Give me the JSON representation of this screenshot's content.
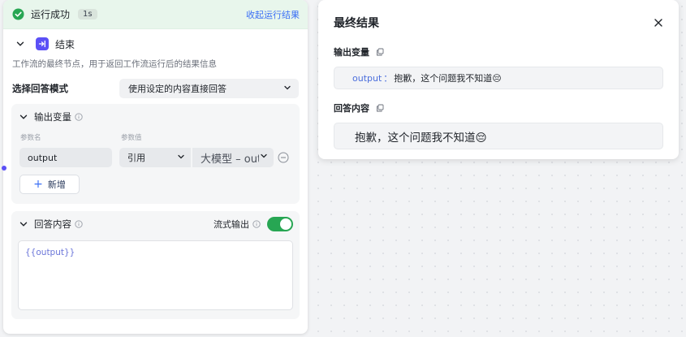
{
  "run_status": {
    "label": "运行成功",
    "time": "1s",
    "collapse_label": "收起运行结果"
  },
  "node": {
    "title": "结束",
    "description": "工作流的最终节点，用于返回工作流运行后的结果信息"
  },
  "answer_mode": {
    "label": "选择回答模式",
    "selected": "使用设定的内容直接回答"
  },
  "output_vars": {
    "title": "输出变量",
    "col_name": "参数名",
    "col_value": "参数值",
    "rows": [
      {
        "name": "output",
        "ref_type": "引用",
        "value": "大模型 – output"
      }
    ],
    "add_label": "新增"
  },
  "answer_content": {
    "title": "回答内容",
    "stream_label": "流式输出",
    "stream_enabled": true,
    "template": "{{output}}"
  },
  "result_panel": {
    "title": "最终结果",
    "output_label": "输出变量",
    "output_key": "output",
    "output_sep": "：",
    "output_value": "抱歉，这个问题我不知道😔",
    "answer_label": "回答内容",
    "answer_value": "抱歉，这个问题我不知道😔"
  },
  "colors": {
    "success": "#27a653",
    "accent": "#3b6ff5",
    "end_node": "#5b50f6"
  },
  "icons": [
    "check-circle-icon",
    "chevron-down-icon",
    "end-node-icon",
    "info-icon",
    "minus-circle-icon",
    "plus-icon",
    "close-icon",
    "copy-icon"
  ]
}
